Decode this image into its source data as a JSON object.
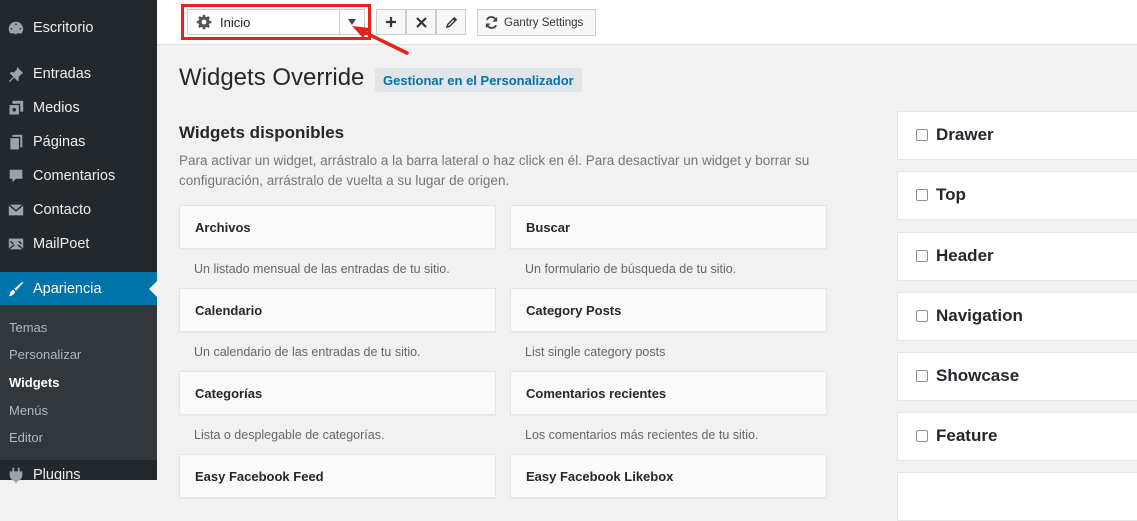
{
  "sidebar": {
    "items": [
      {
        "label": "Escritorio",
        "icon": "dashboard-icon"
      },
      {
        "label": "Entradas",
        "icon": "pin-icon"
      },
      {
        "label": "Medios",
        "icon": "media-icon"
      },
      {
        "label": "Páginas",
        "icon": "pages-icon"
      },
      {
        "label": "Comentarios",
        "icon": "comments-icon"
      },
      {
        "label": "Contacto",
        "icon": "mail-icon"
      },
      {
        "label": "MailPoet",
        "icon": "mailpoet-icon"
      },
      {
        "label": "Apariencia",
        "icon": "brush-icon"
      },
      {
        "label": "Plugins",
        "icon": "plugins-icon"
      }
    ],
    "submenu": [
      "Temas",
      "Personalizar",
      "Widgets",
      "Menús",
      "Editor"
    ]
  },
  "toolbar": {
    "override_value": "Inicio",
    "gantry_label": "Gantry Settings"
  },
  "main": {
    "title": "Widgets Override",
    "manage_link": "Gestionar en el Personalizador",
    "available_heading": "Widgets disponibles",
    "available_desc": "Para activar un widget, arrástralo a la barra lateral o haz click en él. Para desactivar un widget y borrar su configuración, arrástralo de vuelta a su lugar de origen.",
    "widgets": [
      {
        "title": "Archivos",
        "desc": "Un listado mensual de las entradas de tu sitio."
      },
      {
        "title": "Buscar",
        "desc": "Un formulario de búsqueda de tu sitio."
      },
      {
        "title": "Calendario",
        "desc": "Un calendario de las entradas de tu sitio."
      },
      {
        "title": "Category Posts",
        "desc": "List single category posts"
      },
      {
        "title": "Categorías",
        "desc": "Lista o desplegable de categorías."
      },
      {
        "title": "Comentarios recientes",
        "desc": "Los comentarios más recientes de tu sitio."
      },
      {
        "title": "Easy Facebook Feed",
        "desc": ""
      },
      {
        "title": "Easy Facebook Likebox",
        "desc": ""
      }
    ]
  },
  "sidebars": [
    "Drawer",
    "Top",
    "Header",
    "Navigation",
    "Showcase",
    "Feature"
  ],
  "colors": {
    "sidebar_bg": "#23282d",
    "active_blue": "#0073aa",
    "highlight_red": "#e6231b"
  }
}
